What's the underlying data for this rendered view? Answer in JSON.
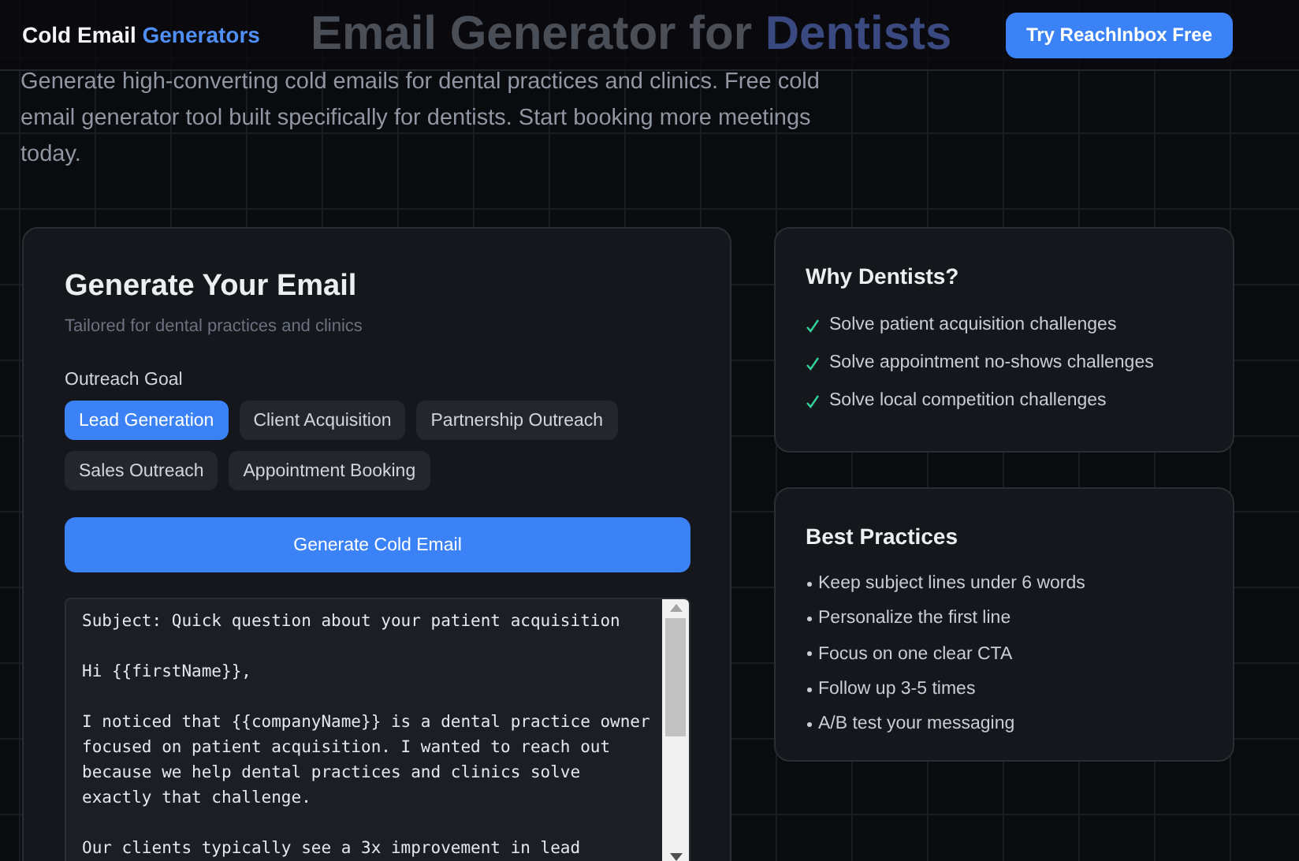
{
  "header": {
    "logo": "Cold Email",
    "logo_accent": "Generators",
    "hero_title": "Email Generator for",
    "hero_accent": "Dentists",
    "cta": "Try ReachInbox Free"
  },
  "description": "Generate high-converting cold emails for dental practices and clinics. Free cold email generator tool built specifically for dentists. Start booking more meetings today.",
  "generator": {
    "title": "Generate Your Email",
    "subtitle": "Tailored for dental practices and clinics",
    "goal_label": "Outreach Goal",
    "goals": [
      {
        "label": "Lead Generation",
        "selected": true
      },
      {
        "label": "Client Acquisition",
        "selected": false
      },
      {
        "label": "Partnership Outreach",
        "selected": false
      },
      {
        "label": "Sales Outreach",
        "selected": false
      },
      {
        "label": "Appointment Booking",
        "selected": false
      }
    ],
    "button": "Generate Cold Email",
    "email_lines": [
      "Subject: Quick question about your patient acquisition",
      "Hi {{firstName}},",
      "I noticed that {{companyName}} is a dental practice owner focused on patient acquisition. I wanted to reach out because we help dental practices and clinics solve exactly that challenge.",
      "Our clients typically see a 3x improvement in lead"
    ]
  },
  "why": {
    "title": "Why Dentists?",
    "items": [
      "Solve patient acquisition challenges",
      "Solve appointment no-shows challenges",
      "Solve local competition challenges"
    ]
  },
  "best_practices": {
    "title": "Best Practices",
    "items": [
      "Keep subject lines under 6 words",
      "Personalize the first line",
      "Focus on one clear CTA",
      "Follow up 3-5 times",
      "A/B test your messaging"
    ]
  }
}
